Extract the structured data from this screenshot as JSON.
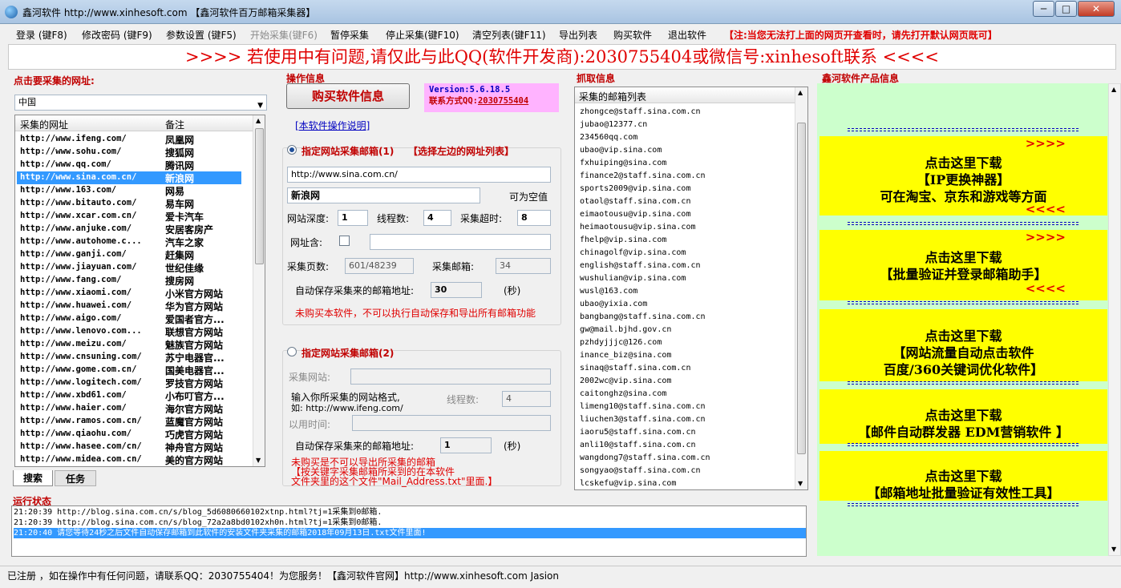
{
  "window": {
    "title": "鑫河软件 http://www.xinhesoft.com 【鑫河软件百万邮箱采集器】",
    "controls": [
      "─",
      "□",
      "✕"
    ]
  },
  "menu": {
    "items": [
      "登录 (键F8)",
      "修改密码 (键F9)",
      "参数设置 (键F5)",
      "开始采集(键F6)",
      "暂停采集",
      "停止采集(键F10)",
      "清空列表(键F11)",
      "导出列表",
      "购买软件",
      "退出软件"
    ],
    "notice": "【注:当您无法打上面的网页开查看时，请先打开默认网页既可】"
  },
  "banner": ">>>> 若使用中有问题,请仅此与此QQ(软件开发商):2030755404或微信号:xinhesoft联系 <<<<",
  "left": {
    "title": "点击要采集的网址:",
    "combo_value": "中国",
    "col_url": "采集的网址",
    "col_note": "备注",
    "rows": [
      {
        "url": "http://www.ifeng.com/",
        "note": "凤凰网"
      },
      {
        "url": "http://www.sohu.com/",
        "note": "搜狐网"
      },
      {
        "url": "http://www.qq.com/",
        "note": "腾讯网"
      },
      {
        "url": "http://www.sina.com.cn/",
        "note": "新浪网"
      },
      {
        "url": "http://www.163.com/",
        "note": "网易"
      },
      {
        "url": "http://www.bitauto.com/",
        "note": "易车网"
      },
      {
        "url": "http://www.xcar.com.cn/",
        "note": "爱卡汽车"
      },
      {
        "url": "http://www.anjuke.com/",
        "note": "安居客房产"
      },
      {
        "url": "http://www.autohome.c...",
        "note": "汽车之家"
      },
      {
        "url": "http://www.ganji.com/",
        "note": "赶集网"
      },
      {
        "url": "http://www.jiayuan.com/",
        "note": "世纪佳缘"
      },
      {
        "url": "http://www.fang.com/",
        "note": "搜房网"
      },
      {
        "url": "http://www.xiaomi.com/",
        "note": "小米官方网站"
      },
      {
        "url": "http://www.huawei.com/",
        "note": "华为官方网站"
      },
      {
        "url": "http://www.aigo.com/",
        "note": "爱国者官方..."
      },
      {
        "url": "http://www.lenovo.com...",
        "note": "联想官方网站"
      },
      {
        "url": "http://www.meizu.com/",
        "note": "魅族官方网站"
      },
      {
        "url": "http://www.cnsuning.com/",
        "note": "苏宁电器官..."
      },
      {
        "url": "http://www.gome.com.cn/",
        "note": "国美电器官..."
      },
      {
        "url": "http://www.logitech.com/",
        "note": "罗技官方网站"
      },
      {
        "url": "http://www.xbd61.com/",
        "note": "小布叮官方..."
      },
      {
        "url": "http://www.haier.com/",
        "note": "海尔官方网站"
      },
      {
        "url": "http://www.ramos.com.cn/",
        "note": "蓝魔官方网站"
      },
      {
        "url": "http://www.qiaohu.com/",
        "note": "巧虎官方网站"
      },
      {
        "url": "http://www.hasee.com/cn/",
        "note": "神舟官方网站"
      },
      {
        "url": "http://www.midea.com.cn/",
        "note": "美的官方网站"
      }
    ],
    "selected_index": 3,
    "tabs": [
      "搜索",
      "任务"
    ]
  },
  "ops": {
    "title": "操作信息",
    "buy_button": "购买软件信息",
    "version": "Version:5.6.18.5",
    "contact_label": "联系方式QQ:",
    "contact_qq": "2030755404",
    "manual_link": "[本软件操作说明]",
    "mode1_label": "指定网站采集邮箱(1)",
    "mode1_hint": "【选择左边的网址列表】",
    "url_value": "http://www.sina.com.cn/",
    "name_value": "新浪网",
    "can_empty": "可为空值",
    "depth_label": "网站深度:",
    "depth_value": "1",
    "threads_label": "线程数:",
    "threads_value": "4",
    "timeout_label": "采集超时:",
    "timeout_value": "8",
    "contains_label": "网址含:",
    "pages_label": "采集页数:",
    "pages_value": "601/48239",
    "emails_label": "采集邮箱:",
    "emails_value": "34",
    "autosave_label": "自动保存采集来的邮箱地址:",
    "autosave_value": "30",
    "seconds": "(秒)",
    "warn1": "未购买本软件，不可以执行自动保存和导出所有邮箱功能",
    "mode2_label": "指定网站采集邮箱(2)",
    "site_label": "采集网站:",
    "input_hint_1": "输入你所采集的网站格式,",
    "input_hint_2": "如: http://www.ifeng.com/",
    "threads2_label": "线程数:",
    "threads2_value": "4",
    "time_label": "以用时间:",
    "autosave2_label": "自动保存采集来的邮箱地址:",
    "autosave2_value": "1",
    "seconds2": "(秒)",
    "warn2_1": "未购买是不可以导出所采集的邮箱",
    "warn2_2": "【按关键字采集邮箱所采到的在本软件",
    "warn2_3": "文件夹里的这个文件\"Mail_Address.txt\"里面.】"
  },
  "grab": {
    "title": "抓取信息",
    "col": "采集的邮箱列表",
    "emails": [
      "zhongce@staff.sina.com.cn",
      "jubao@12377.cn",
      "234560qq.com",
      "ubao@vip.sina.com",
      "fxhuiping@sina.com",
      "finance2@staff.sina.com.cn",
      "sports2009@vip.sina.com",
      "otaol@staff.sina.com.cn",
      "eimaotousu@vip.sina.com",
      "heimaotousu@vip.sina.com",
      "fhelp@vip.sina.com",
      "chinagolf@vip.sina.com",
      "english@staff.sina.com.cn",
      "wushulian@vip.sina.com",
      "wusl@163.com",
      "ubao@yixia.com",
      "bangbang@staff.sina.com.cn",
      "gw@mail.bjhd.gov.cn",
      "pzhdyjjjc@126.com",
      "inance_biz@sina.com",
      "sinaq@staff.sina.com.cn",
      "2002wc@vip.sina.com",
      "caitonghz@sina.com",
      "limeng10@staff.sina.com.cn",
      "liuchen3@staff.sina.com.cn",
      "iaoru5@staff.sina.com.cn",
      "anli10@staff.sina.com.cn",
      "wangdong7@staff.sina.com.cn",
      "songyao@staff.sina.com.cn",
      "lcskefu@vip.sina.com"
    ]
  },
  "products": {
    "title": "鑫河软件产品信息",
    "sep": "==============================================",
    "arrows_right": ">>>>",
    "arrows_left": "<<<<",
    "ads": [
      {
        "l1": "点击这里下载",
        "l2": "【IP更换神器】",
        "l3": "可在淘宝、京东和游戏等方面"
      },
      {
        "l1": "点击这里下载",
        "l2": "【批量验证并登录邮箱助手】",
        "l3": ""
      },
      {
        "l1": "点击这里下载",
        "l2": "【网站流量自动点击软件",
        "l3": "百度/360关键词优化软件】"
      },
      {
        "l1": "点击这里下载",
        "l2": "【邮件自动群发器 EDM营销软件 】",
        "l3": ""
      },
      {
        "l1": "点击这里下载",
        "l2": "【邮箱地址批量验证有效性工具】",
        "l3": ""
      }
    ]
  },
  "log": {
    "title": "运行状态",
    "lines": [
      "21:20:39 http://blog.sina.com.cn/s/blog_5d6080660102xtnp.html?tj=1采集到0邮箱.",
      "21:20:39 http://blog.sina.com.cn/s/blog_72a2a8bd0102xh0n.html?tj=1采集到0邮箱.",
      "21:20:40 请您等待24秒之后文件自动保存邮箱到此软件的安装文件夹采集的邮箱2018年09月13日.txt文件里面!"
    ],
    "selected_index": 2
  },
  "status": "已注册 ，如在操作中有任何问题，请联系QQ：2030755404！为您服务！【鑫河软件官网】http://www.xinhesoft.com   Jasion",
  "colors": {
    "accent_red": "#e00000",
    "select_blue": "#3399ff",
    "ad_yellow": "#ffff00",
    "panel_green": "#ccffcc",
    "version_bg": "#ffb3ff"
  }
}
